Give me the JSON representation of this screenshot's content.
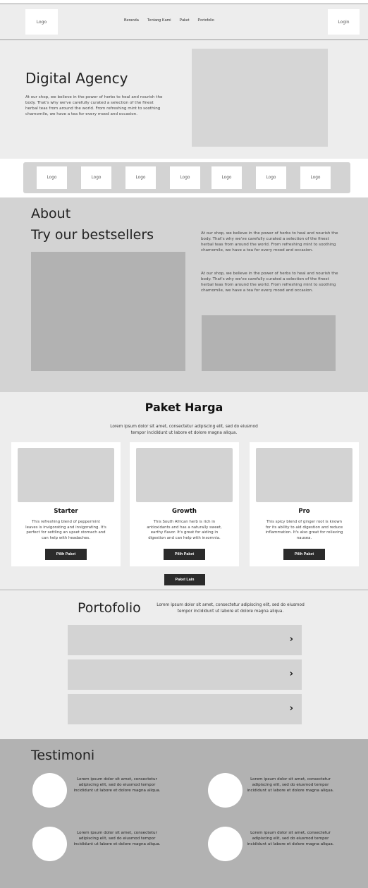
{
  "nav": {
    "logo": "Logo",
    "menu": [
      "Beranda",
      "Tentang Kami",
      "Paket",
      "Portofolio"
    ],
    "login": "Login"
  },
  "hero": {
    "title": "Digital Agency",
    "text": "At our shop, we believe in the power of herbs to heal and nourish the body. That's why we've carefully curated a selection of the finest herbal teas from around the world. From refreshing mint to soothing chamomile, we have a tea for every mood and occasion."
  },
  "logos": [
    "Logo",
    "Logo",
    "Logo",
    "Logo",
    "Logo",
    "Logo",
    "Logo"
  ],
  "about": {
    "title": "About",
    "subtitle": "Try our bestsellers",
    "para1": "At our shop, we believe in the power of herbs to heal and nourish the body. That's why we've carefully curated a selection of the finest herbal teas from around the world. From refreshing mint to soothing chamomile, we have a tea for every mood and occasion.",
    "para2": "At our shop, we believe in the power of herbs to heal and nourish the body. That's why we've carefully curated a selection of the finest herbal teas from around the world. From refreshing mint to soothing chamomile, we have a tea for every mood and occasion."
  },
  "pricing": {
    "title": "Paket Harga",
    "subtitle": "Lorem ipsum dolor sit amet, consectetur adipiscing elit, sed do eiusmod tempor incididunt ut labore et dolore magna aliqua.",
    "cards": [
      {
        "title": "Starter",
        "desc": "This refreshing blend of peppermint leaves is invigorating and invigorating. It's perfect for settling an upset stomach and can help with headaches.",
        "button": "Pilih Paket"
      },
      {
        "title": "Growth",
        "desc": "This South African herb is rich in antioxidants and has a naturally sweet, earthy flavor. It's great for aiding in digestion and can help with insomnia.",
        "button": "Pilih Paket"
      },
      {
        "title": "Pro",
        "desc": "This spicy blend of ginger root is known for its ability to aid digestion and reduce inflammation. It's also great for relieving nausea.",
        "button": "Pilih Paket"
      }
    ],
    "more_button": "Paket Lain"
  },
  "portfolio": {
    "title": "Portofolio",
    "desc": "Lorem ipsum dolor sit amet, consectetur adipiscing elit, sed do eiusmod tempor incididunt ut labore et dolore magna aliqua.",
    "chevron": "›"
  },
  "testimoni": {
    "title": "Testimoni",
    "items": [
      {
        "text": "Lorem ipsum dolor sit amet, consectetur adipiscing elit, sed do eiusmod tempor incididunt ut labore et dolore magna aliqua."
      },
      {
        "text": "Lorem ipsum dolor sit amet, consectetur adipiscing elit, sed do eiusmod tempor incididunt ut labore et dolore magna aliqua."
      },
      {
        "text": "Lorem ipsum dolor sit amet, consectetur adipiscing elit, sed do eiusmod tempor incididunt ut labore et dolore magna aliqua."
      },
      {
        "text": "Lorem ipsum dolor sit amet, consectetur adipiscing elit, sed do eiusmod tempor incididunt ut labore et dolore magna aliqua."
      }
    ]
  }
}
